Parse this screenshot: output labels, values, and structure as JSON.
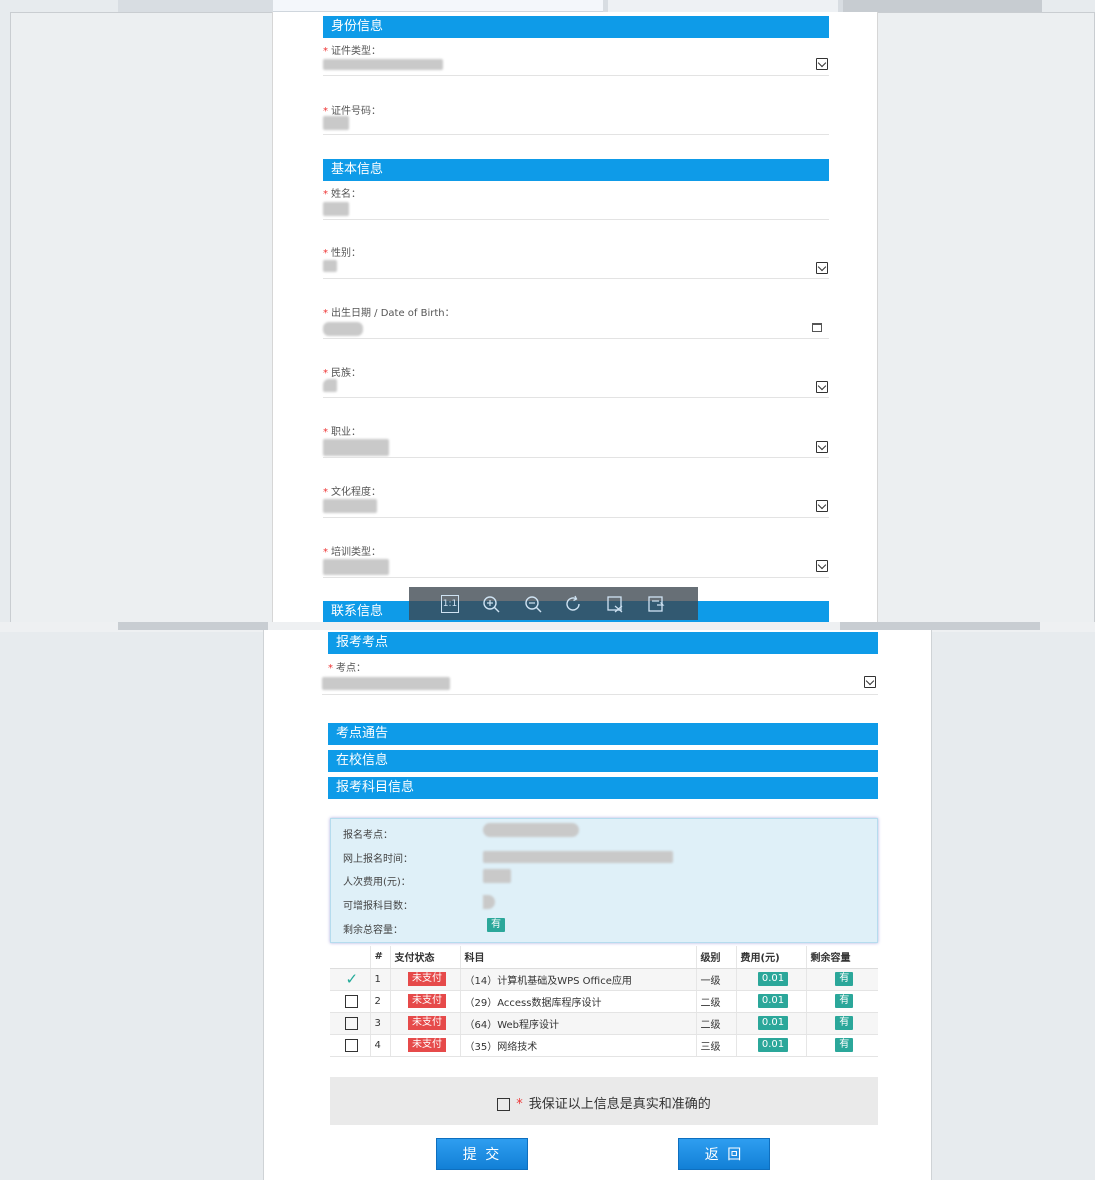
{
  "top_form": {
    "sections": {
      "identity": "身份信息",
      "basic": "基本信息",
      "contact": "联系信息"
    },
    "fields": {
      "id_type": "证件类型：",
      "id_number": "证件号码：",
      "name": "姓名：",
      "gender": "性别：",
      "birth_date": "出生日期 / Date of Birth：",
      "ethnicity": "民族：",
      "occupation": "职业：",
      "education": "文化程度：",
      "training_type": "培训类型："
    }
  },
  "viewer_toolbar": {
    "actual_size": "1:1"
  },
  "bottom_form": {
    "sections": {
      "exam_site": "报考考点",
      "site_notice": "考点通告",
      "school_info": "在校信息",
      "subject_info": "报考科目信息"
    },
    "exam_site_label": "考点：",
    "info": {
      "site_label": "报名考点：",
      "time_label": "网上报名时间：",
      "fee_label": "人次费用(元)：",
      "count_label": "可增报科目数：",
      "capacity_label": "剩余总容量：",
      "capacity_value": "有"
    },
    "table": {
      "headers": [
        "#",
        "支付状态",
        "科目",
        "级别",
        "费用(元)",
        "剩余容量"
      ],
      "rows": [
        {
          "num": "1",
          "status": "未支付",
          "subject": "（14）计算机基础及WPS Office应用",
          "level": "一级",
          "fee": "0.01",
          "capacity": "有",
          "checked": true
        },
        {
          "num": "2",
          "status": "未支付",
          "subject": "（29）Access数据库程序设计",
          "level": "二级",
          "fee": "0.01",
          "capacity": "有",
          "checked": false
        },
        {
          "num": "3",
          "status": "未支付",
          "subject": "（64）Web程序设计",
          "level": "二级",
          "fee": "0.01",
          "capacity": "有",
          "checked": false
        },
        {
          "num": "4",
          "status": "未支付",
          "subject": "（35）网络技术",
          "level": "三级",
          "fee": "0.01",
          "capacity": "有",
          "checked": false
        }
      ]
    },
    "confirm": {
      "asterisk": "*",
      "text": "我保证以上信息是真实和准确的"
    },
    "buttons": {
      "submit": "提 交",
      "back": "返 回"
    }
  }
}
